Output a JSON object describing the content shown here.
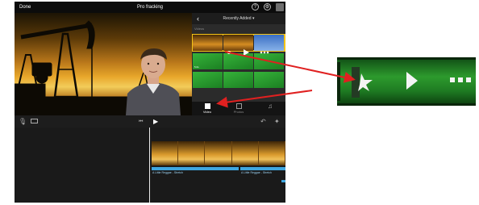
{
  "app": {
    "done_label": "Done",
    "title": "Pro fracking",
    "help_icon": "help-icon",
    "settings_icon": "settings-gear-icon",
    "share_icon": "share-icon"
  },
  "browser": {
    "back_icon": "chevron-left-icon",
    "dropdown_label": "Recently Added ▾",
    "section_label": "Videos",
    "durations": [
      "",
      "",
      "",
      "5.0s",
      "",
      "",
      "",
      "",
      ""
    ],
    "tabs": [
      {
        "label": "Video",
        "icon": "film-icon",
        "active": true
      },
      {
        "label": "Photos",
        "icon": "photo-icon",
        "active": false
      },
      {
        "label": "",
        "icon": "music-note-icon",
        "active": false
      }
    ]
  },
  "controls": {
    "mic_icon": "microphone-icon",
    "camera_icon": "camera-icon",
    "undo_icon": "undo-icon",
    "settings_icon": "gear-icon",
    "skip_icon": "skip-back-icon",
    "play_icon": "play-icon"
  },
  "timeline": {
    "audio_tracks": [
      {
        "label": "A Little Reggae - Stretch"
      },
      {
        "label": "A Little Reggae - Stretch"
      }
    ]
  },
  "colors": {
    "accent_yellow": "#f3c316",
    "audio_blue": "#3fa7e0",
    "arrow_red": "#e02020"
  }
}
